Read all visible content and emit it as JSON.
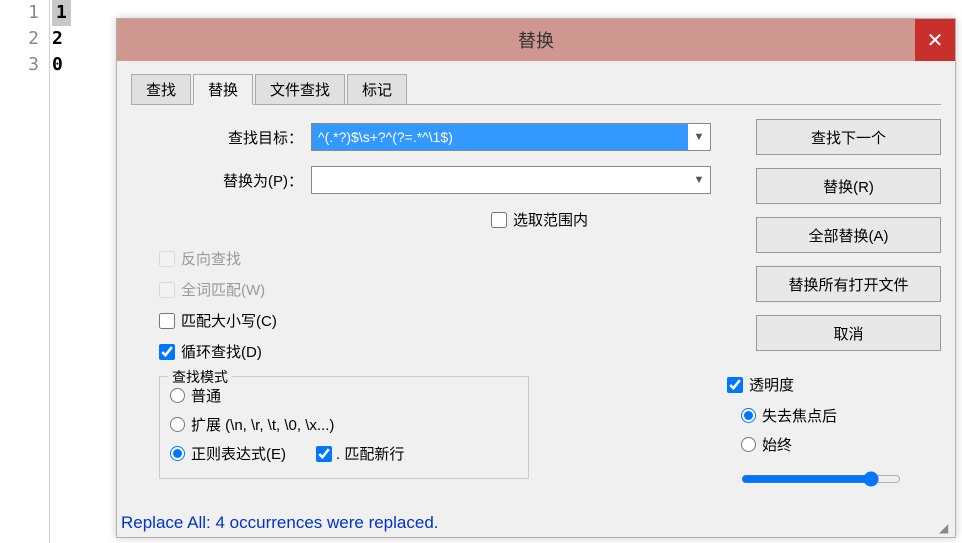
{
  "editor": {
    "lines": [
      "1",
      "2",
      "0"
    ],
    "gutter": [
      "1",
      "2",
      "3"
    ]
  },
  "dialog": {
    "title": "替换",
    "close": "✕",
    "tabs": {
      "find": "查找",
      "replace": "替换",
      "findfiles": "文件查找",
      "mark": "标记"
    },
    "labels": {
      "find_target": "查找目标：",
      "replace_with": "替换为(P)："
    },
    "inputs": {
      "find_value": "^(.*?)$\\s+?^(?=.*^\\1$)",
      "replace_value": ""
    },
    "checkboxes": {
      "in_selection": "选取范围内",
      "backward": "反向查找",
      "whole_word": "全词匹配(W)",
      "match_case": "匹配大小写(C)",
      "wrap": "循环查找(D)"
    },
    "buttons": {
      "find_next": "查找下一个",
      "replace": "替换(R)",
      "replace_all": "全部替换(A)",
      "replace_all_open": "替换所有打开文件",
      "cancel": "取消"
    },
    "search_mode": {
      "title": "查找模式",
      "normal": "普通",
      "extended": "扩展 (\\n, \\r, \\t, \\0, \\x...)",
      "regex": "正则表达式(E)",
      "dot_newline": ". 匹配新行"
    },
    "transparency": {
      "label": "透明度",
      "on_lose_focus": "失去焦点后",
      "always": "始终"
    },
    "status": "Replace All: 4 occurrences were replaced."
  }
}
